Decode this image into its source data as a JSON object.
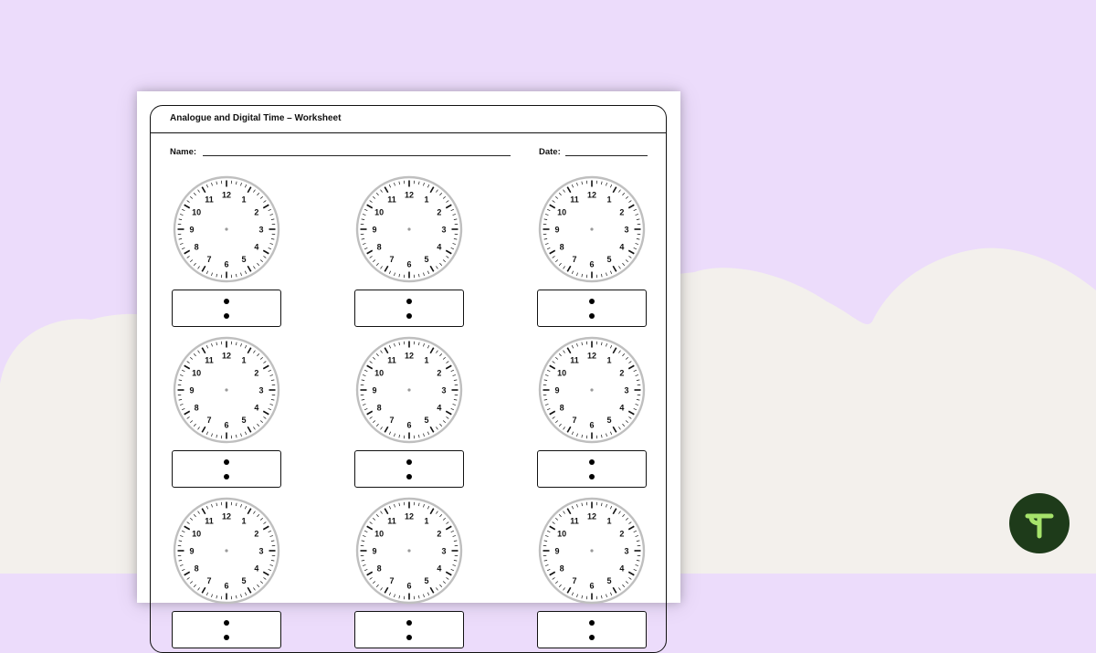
{
  "worksheet": {
    "title": "Analogue and Digital Time – Worksheet",
    "name_label": "Name:",
    "date_label": "Date:"
  },
  "clock_face": {
    "numerals": [
      "12",
      "1",
      "2",
      "3",
      "4",
      "5",
      "6",
      "7",
      "8",
      "9",
      "10",
      "11"
    ]
  },
  "grid": {
    "columns": 3,
    "rows": 3
  },
  "colors": {
    "background_lavender": "#ecdcfb",
    "background_cloud": "#f3f0ec",
    "clock_rim": "#bfbfbf",
    "logo_green": "#1e3b1a",
    "logo_accent": "#a6e36b"
  },
  "icons": {
    "brand": "sprout-logo-icon"
  }
}
